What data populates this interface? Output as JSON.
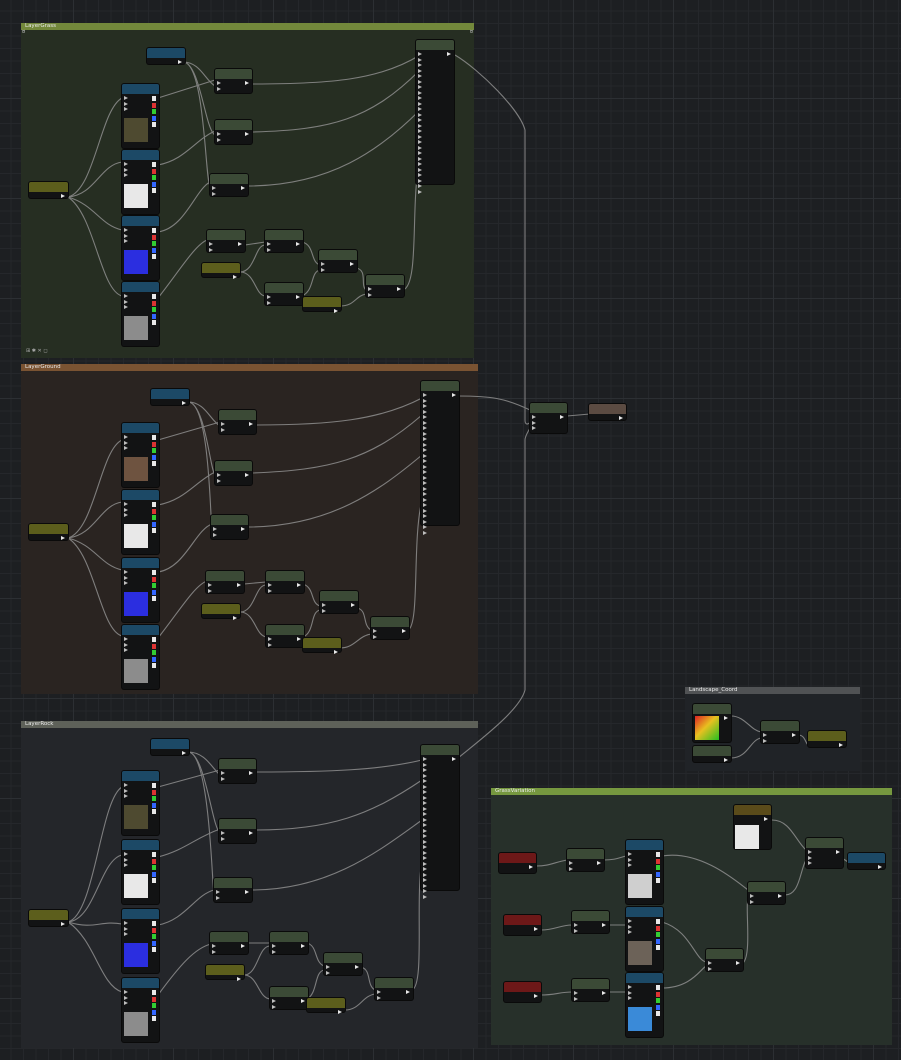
{
  "canvas": {
    "comments": [
      {
        "id": "grass",
        "title": "LayerGrass",
        "color": "#73883b",
        "body": "#262e22"
      },
      {
        "id": "ground",
        "title": "LayerGround",
        "color": "#7a5332",
        "body": "#2a2421"
      },
      {
        "id": "rock",
        "title": "LayerRock",
        "color": "#5e6159",
        "body": "#24262a"
      },
      {
        "id": "coord",
        "title": "Landscape_Coord",
        "color": "#505254",
        "body": "#202327"
      },
      {
        "id": "variation",
        "title": "GrassVariation",
        "color": "#76983f",
        "body": "#27302a"
      }
    ],
    "header_colors": {
      "blue": "#1c4966",
      "green": "#3b4a36",
      "olive": "#5c5e1c",
      "brown": "#5b4b42",
      "red": "#6d1818",
      "yellowbrown": "#5a4b1a"
    },
    "textures": {
      "moss": "#4e4a30",
      "white": "#e8e8e8",
      "normal_blue": "#2b2ee0",
      "gray_noise": "#8c8c8c",
      "dirt": "#6e5340",
      "white_gradient": "#cfcfcf",
      "rock": "#6c6258",
      "water_blue": "#3a8ad8"
    },
    "corner_glyphs": {
      "grass_left": "¤",
      "grass_right": "¤"
    },
    "grass_toolbar": "⊞ ✱ ✕ ◻"
  }
}
